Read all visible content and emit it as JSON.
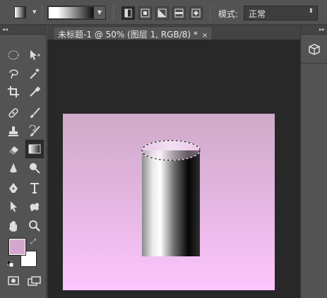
{
  "options_bar": {
    "tool_preset_icon": "gradient-tool-preset-icon",
    "gradient_type_icons": [
      "linear-gradient-icon",
      "radial-gradient-icon",
      "angle-gradient-icon",
      "reflected-gradient-icon",
      "diamond-gradient-icon"
    ],
    "mode_label": "模式:",
    "mode_value": "正常"
  },
  "document": {
    "tab_title": "未标题-1 @ 50% (图层 1, RGB/8) *",
    "close_glyph": "×"
  },
  "toolbox": {
    "collapse_glyph": "◂◂",
    "foreground_color": "#d4a8cd",
    "background_color": "#ffffff"
  },
  "dock": {
    "collapse_glyph": "▸▸",
    "panel_icon": "3d-cube-panel-icon"
  },
  "colors": {
    "ui_bg": "#535353",
    "canvas_bg": "#282828",
    "artboard_top": "#cfaac9",
    "artboard_bottom": "#fdc6fd"
  }
}
